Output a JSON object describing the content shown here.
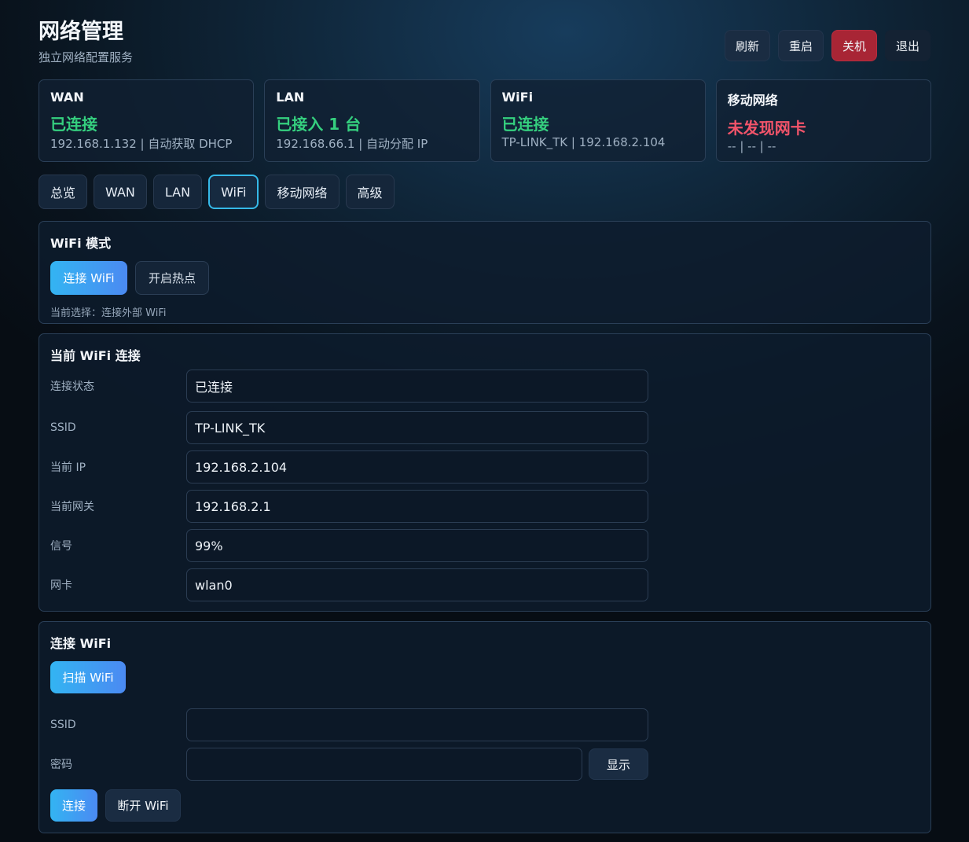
{
  "header": {
    "title": "网络管理",
    "subtitle": "独立网络配置服务",
    "actions": {
      "refresh": "刷新",
      "restart": "重启",
      "shutdown": "关机",
      "logout": "退出"
    }
  },
  "stats": {
    "wan": {
      "label": "WAN",
      "status": "已连接",
      "detail": "192.168.1.132 | 自动获取 DHCP"
    },
    "lan": {
      "label": "LAN",
      "status": "已接入 1 台",
      "detail": "192.168.66.1 | 自动分配 IP"
    },
    "wifi": {
      "label": "WiFi",
      "status": "已连接",
      "detail": "TP-LINK_TK | 192.168.2.104"
    },
    "mobile": {
      "label": "移动网络",
      "status": "未发现网卡",
      "detail": "-- | -- | --"
    }
  },
  "tabs": [
    "总览",
    "WAN",
    "LAN",
    "WiFi",
    "移动网络",
    "高级"
  ],
  "wifi_mode": {
    "title": "WiFi 模式",
    "connect_label": "连接 WiFi",
    "hotspot_label": "开启热点",
    "hint": "当前选择：连接外部 WiFi"
  },
  "current_wifi": {
    "title": "当前 WiFi 连接",
    "rows": [
      {
        "label": "连接状态",
        "value": "已连接"
      },
      {
        "label": "SSID",
        "value": "TP-LINK_TK"
      },
      {
        "label": "当前 IP",
        "value": "192.168.2.104"
      },
      {
        "label": "当前网关",
        "value": "192.168.2.1"
      },
      {
        "label": "信号",
        "value": "99%"
      },
      {
        "label": "网卡",
        "value": "wlan0"
      }
    ]
  },
  "connect_wifi": {
    "title": "连接 WiFi",
    "scan_label": "扫描 WiFi",
    "ssid_label": "SSID",
    "ssid_value": "",
    "password_label": "密码",
    "password_value": "",
    "show_label": "显示",
    "connect_label": "连接",
    "disconnect_label": "断开 WiFi"
  },
  "colors": {
    "ok": "#35d07f",
    "error": "#f2546a",
    "accent": "#35b9e8",
    "danger": "#a82535"
  }
}
